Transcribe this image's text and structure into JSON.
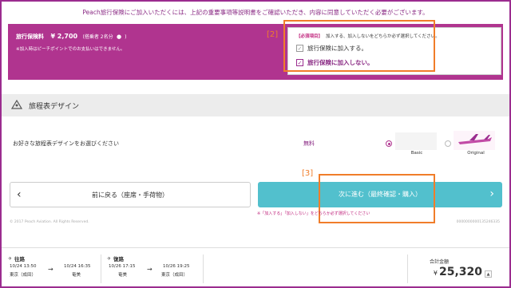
{
  "notice_text": "Peach旅行保険にご加入いただくには、上記の重要事項等説明書をご確認いただき、内容に同意していただく必要がございます。",
  "insurance": {
    "fee_label": "旅行保険料",
    "fee_amount": "¥ 2,700",
    "fee_count": "(搭乗者 2名分",
    "fee_close": ")",
    "note": "※加入時はピーチポイントでのお支払いはできません。",
    "required_tag": "【必須項目】",
    "required_text": "加入する、加入しないをどちらか必ず選択してください。",
    "option_join": "旅行保険に加入する。",
    "option_not_join": "旅行保険に加入しない。",
    "selected": "option_not_join"
  },
  "annotations": {
    "label_2": "[2]",
    "label_3": "[3]",
    "color": "#f07d2a"
  },
  "design": {
    "title": "旅程表デザイン",
    "prompt": "お好きな旅程表デザインをお選びください",
    "price": "無料",
    "options": [
      {
        "label": "Basic",
        "selected": true
      },
      {
        "label": "Original",
        "selected": false
      }
    ]
  },
  "buttons": {
    "back": "前に戻る（座席・手荷物）",
    "next": "次に進む（最終確認・購入）"
  },
  "warning": "※「加入する」「加入しない」をどちらか必ず選択してください",
  "copyright": "© 2017 Peach Aviation. All Rights Reserved.",
  "reference": "0000000000135246335",
  "itinerary": {
    "outbound": {
      "title": "往路",
      "dep": "10/24 13:50",
      "dep_place": "東京（成田）",
      "arr": "10/24 16:35",
      "arr_place": "奄美",
      "arrow": "→"
    },
    "return": {
      "title": "復路",
      "dep": "10/26 17:15",
      "dep_place": "奄美",
      "arr": "10/26 19:25",
      "arr_place": "東京（成田）",
      "arrow": "→"
    }
  },
  "total": {
    "label": "合計金額",
    "currency": "¥",
    "amount": "25,320"
  },
  "colors": {
    "brand_purple": "#b0348f",
    "next_button": "#52c0cd",
    "annotation_orange": "#f07d2a"
  }
}
